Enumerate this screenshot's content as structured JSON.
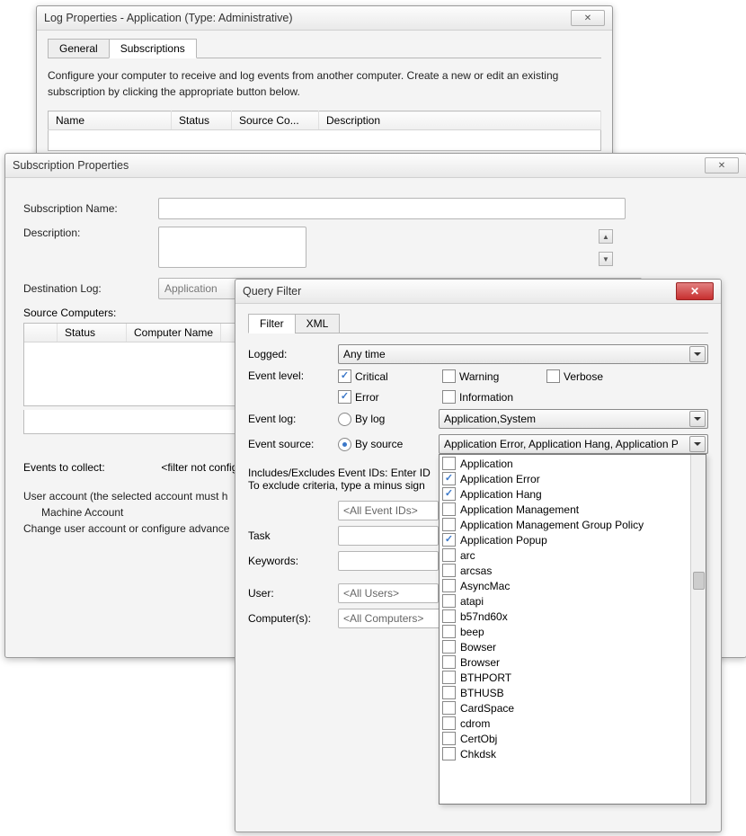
{
  "win1": {
    "title": "Log Properties - Application (Type: Administrative)",
    "tabs": {
      "general": "General",
      "subscriptions": "Subscriptions"
    },
    "desc": "Configure your computer to receive and log events from another computer.  Create a new or edit an existing subscription by clicking the appropriate button below.",
    "cols": {
      "name": "Name",
      "status": "Status",
      "source": "Source Co...",
      "desc": "Description"
    }
  },
  "win2": {
    "title": "Subscription Properties",
    "labels": {
      "sub_name": "Subscription Name:",
      "description": "Description:",
      "dest_log": "Destination Log:",
      "src_comp": "Source Computers:",
      "events": "Events to collect:",
      "filter_status": "<filter not configu",
      "user_acct": "User account (the selected account must h",
      "machine": "Machine Account",
      "change": "Change user account or configure advance"
    },
    "dest_value": "Application",
    "status_col": "Status",
    "comp_col": "Computer Name"
  },
  "win3": {
    "title": "Query Filter",
    "tabs": {
      "filter": "Filter",
      "xml": "XML"
    },
    "labels": {
      "logged": "Logged:",
      "event_level": "Event level:",
      "event_log": "Event log:",
      "event_source": "Event source:",
      "include_a": "Includes/Excludes Event IDs: Enter ID",
      "include_b": "To exclude criteria, type a minus sign",
      "task": "Task",
      "keywords": "Keywords:",
      "user": "User:",
      "computers": "Computer(s):"
    },
    "logged_value": "Any time",
    "levels": {
      "critical": "Critical",
      "warning": "Warning",
      "verbose": "Verbose",
      "error": "Error",
      "information": "Information"
    },
    "by_log": "By log",
    "by_source": "By source",
    "eventlog_value": "Application,System",
    "eventsource_value": "Application Error, Application Hang, Application P",
    "all_event_ids": "<All Event IDs>",
    "all_users": "<All Users>",
    "all_computers": "<All Computers>",
    "sources": [
      {
        "label": "Application",
        "checked": false
      },
      {
        "label": "Application Error",
        "checked": true
      },
      {
        "label": "Application Hang",
        "checked": true
      },
      {
        "label": "Application Management",
        "checked": false
      },
      {
        "label": "Application Management Group Policy",
        "checked": false
      },
      {
        "label": "Application Popup",
        "checked": true
      },
      {
        "label": "arc",
        "checked": false
      },
      {
        "label": "arcsas",
        "checked": false
      },
      {
        "label": "AsyncMac",
        "checked": false
      },
      {
        "label": "atapi",
        "checked": false
      },
      {
        "label": "b57nd60x",
        "checked": false
      },
      {
        "label": "beep",
        "checked": false
      },
      {
        "label": "Bowser",
        "checked": false
      },
      {
        "label": "Browser",
        "checked": false
      },
      {
        "label": "BTHPORT",
        "checked": false
      },
      {
        "label": "BTHUSB",
        "checked": false
      },
      {
        "label": "CardSpace",
        "checked": false
      },
      {
        "label": "cdrom",
        "checked": false
      },
      {
        "label": "CertObj",
        "checked": false
      },
      {
        "label": "Chkdsk",
        "checked": false
      }
    ]
  },
  "close_glyph": "✕"
}
